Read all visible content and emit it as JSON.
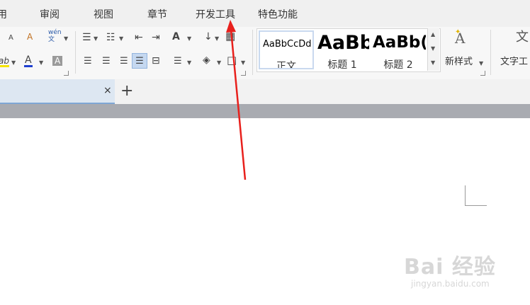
{
  "menu": {
    "partial_left": "用",
    "items": [
      "审阅",
      "视图",
      "章节",
      "开发工具",
      "特色功能"
    ]
  },
  "toolbar": {
    "font_shrink": "A",
    "clear_format": "A",
    "pinyin": "wén\n文",
    "highlight": "ab",
    "font_color": "A",
    "char_shade": "A",
    "bullets": "☰",
    "numbering": "☷",
    "indent_dec": "⇤",
    "indent_inc": "⇥",
    "char_spacing": "A",
    "sort": "↓",
    "table_grid": "▦",
    "align_left": "☰",
    "align_center": "☰",
    "align_right": "☰",
    "justify": "☰",
    "distributed": "⊟",
    "line_spacing": "☰",
    "shading": "◈",
    "borders": "□"
  },
  "styles": [
    {
      "preview": "AaBbCcDd",
      "name": "正文"
    },
    {
      "preview": "AaBb",
      "name": "标题 1"
    },
    {
      "preview": "AaBb(",
      "name": "标题 2"
    }
  ],
  "new_style": {
    "label": "新样式",
    "icon_text": "A"
  },
  "text_tools": {
    "label": "文字工",
    "icon_text": "文"
  },
  "tabs": {
    "close": "×",
    "add": "+"
  },
  "watermark": {
    "main": "Bai 经验",
    "sub": "jingyan.baidu.com"
  },
  "colors": {
    "annotation_arrow": "#e8201c",
    "tab_active": "#dde7f2",
    "accent_blue": "#c9d9ef"
  }
}
